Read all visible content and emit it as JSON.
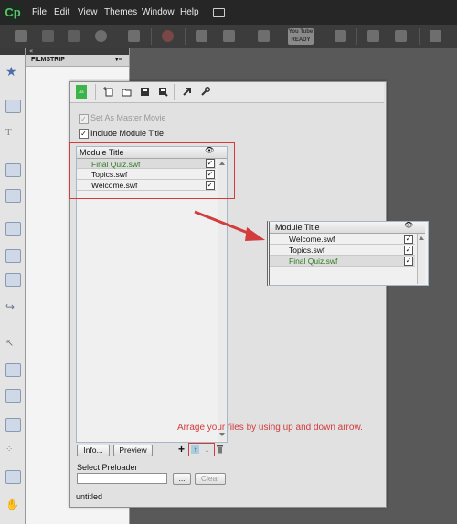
{
  "app": {
    "logo_text": "Cp"
  },
  "menu": [
    "File",
    "Edit",
    "View",
    "Themes",
    "Window",
    "Help"
  ],
  "filmstrip": {
    "title": "FILMSTRIP",
    "menu_glyph": "▾≡",
    "collapse_glyph": "«"
  },
  "toolbar": {
    "youtube_label": "You Tube",
    "youtube_sub": "READY"
  },
  "dialog": {
    "set_master_label": "Set As Master Movie",
    "set_master_checked": true,
    "include_title_label": "Include Module Title",
    "include_title_checked": true,
    "list": {
      "column_header": "Module Title",
      "rows": [
        {
          "name": "Final Quiz.swf",
          "checked": true,
          "selected": true
        },
        {
          "name": "Topics.swf",
          "checked": true,
          "selected": false
        },
        {
          "name": "Welcome.swf",
          "checked": true,
          "selected": false
        }
      ]
    },
    "info_button": "Info...",
    "preview_button": "Preview",
    "add_glyph": "+",
    "up_glyph": "↑",
    "down_glyph": "↓",
    "preloader_label": "Select Preloader",
    "preloader_value": "",
    "browse_button": "...",
    "clear_button": "Clear",
    "status_text": "untitled"
  },
  "annotation": {
    "instruction": "Arrage your files by using up and down arrow.",
    "accent_color": "#d23c3c",
    "reordered_list": {
      "column_header": "Module Title",
      "rows": [
        {
          "name": "Welcome.swf",
          "checked": true,
          "selected": false
        },
        {
          "name": "Topics.swf",
          "checked": true,
          "selected": false
        },
        {
          "name": "Final Quiz.swf",
          "checked": true,
          "selected": true
        }
      ]
    }
  },
  "colors": {
    "selected_text": "#2e7d20",
    "menubar": "#262626",
    "dialog_bg": "#e1e1e1"
  }
}
